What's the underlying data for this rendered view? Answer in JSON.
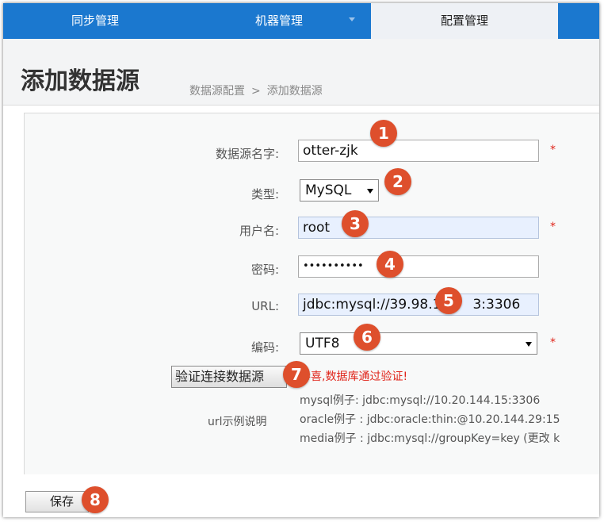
{
  "nav": {
    "tabs": [
      {
        "label": "同步管理"
      },
      {
        "label": "机器管理"
      },
      {
        "label": "配置管理"
      }
    ]
  },
  "header": {
    "title": "添加数据源",
    "breadcrumb": [
      "数据源配置",
      ">",
      "添加数据源"
    ]
  },
  "form": {
    "name_label": "数据源名字:",
    "name_value": "otter-zjk",
    "type_label": "类型:",
    "type_value": "MySQL",
    "user_label": "用户名:",
    "user_value": "root",
    "password_label": "密码:",
    "password_value": "••••••••••",
    "url_label": "URL:",
    "url_value": "jdbc:mysql://39.98.1",
    "url_value_tail": "3:3306",
    "encoding_label": "编码:",
    "encoding_value": "UTF8",
    "required_mark": "*"
  },
  "verify": {
    "button_label": "验证连接数据源",
    "success_text": "恭喜,数据库通过验证!"
  },
  "examples": {
    "label": "url示例说明",
    "lines": [
      "mysql例子: jdbc:mysql://10.20.144.15:3306",
      "oracle例子 : jdbc:oracle:thin:@10.20.144.29:15",
      "media例子 : jdbc:mysql://groupKey=key (更改 k"
    ]
  },
  "save_label": "保存",
  "badges": [
    "1",
    "2",
    "3",
    "4",
    "5",
    "6",
    "7",
    "8"
  ],
  "colors": {
    "nav_bg": "#1b78cf",
    "badge": "#de4f2c",
    "required": "#e0251b"
  }
}
